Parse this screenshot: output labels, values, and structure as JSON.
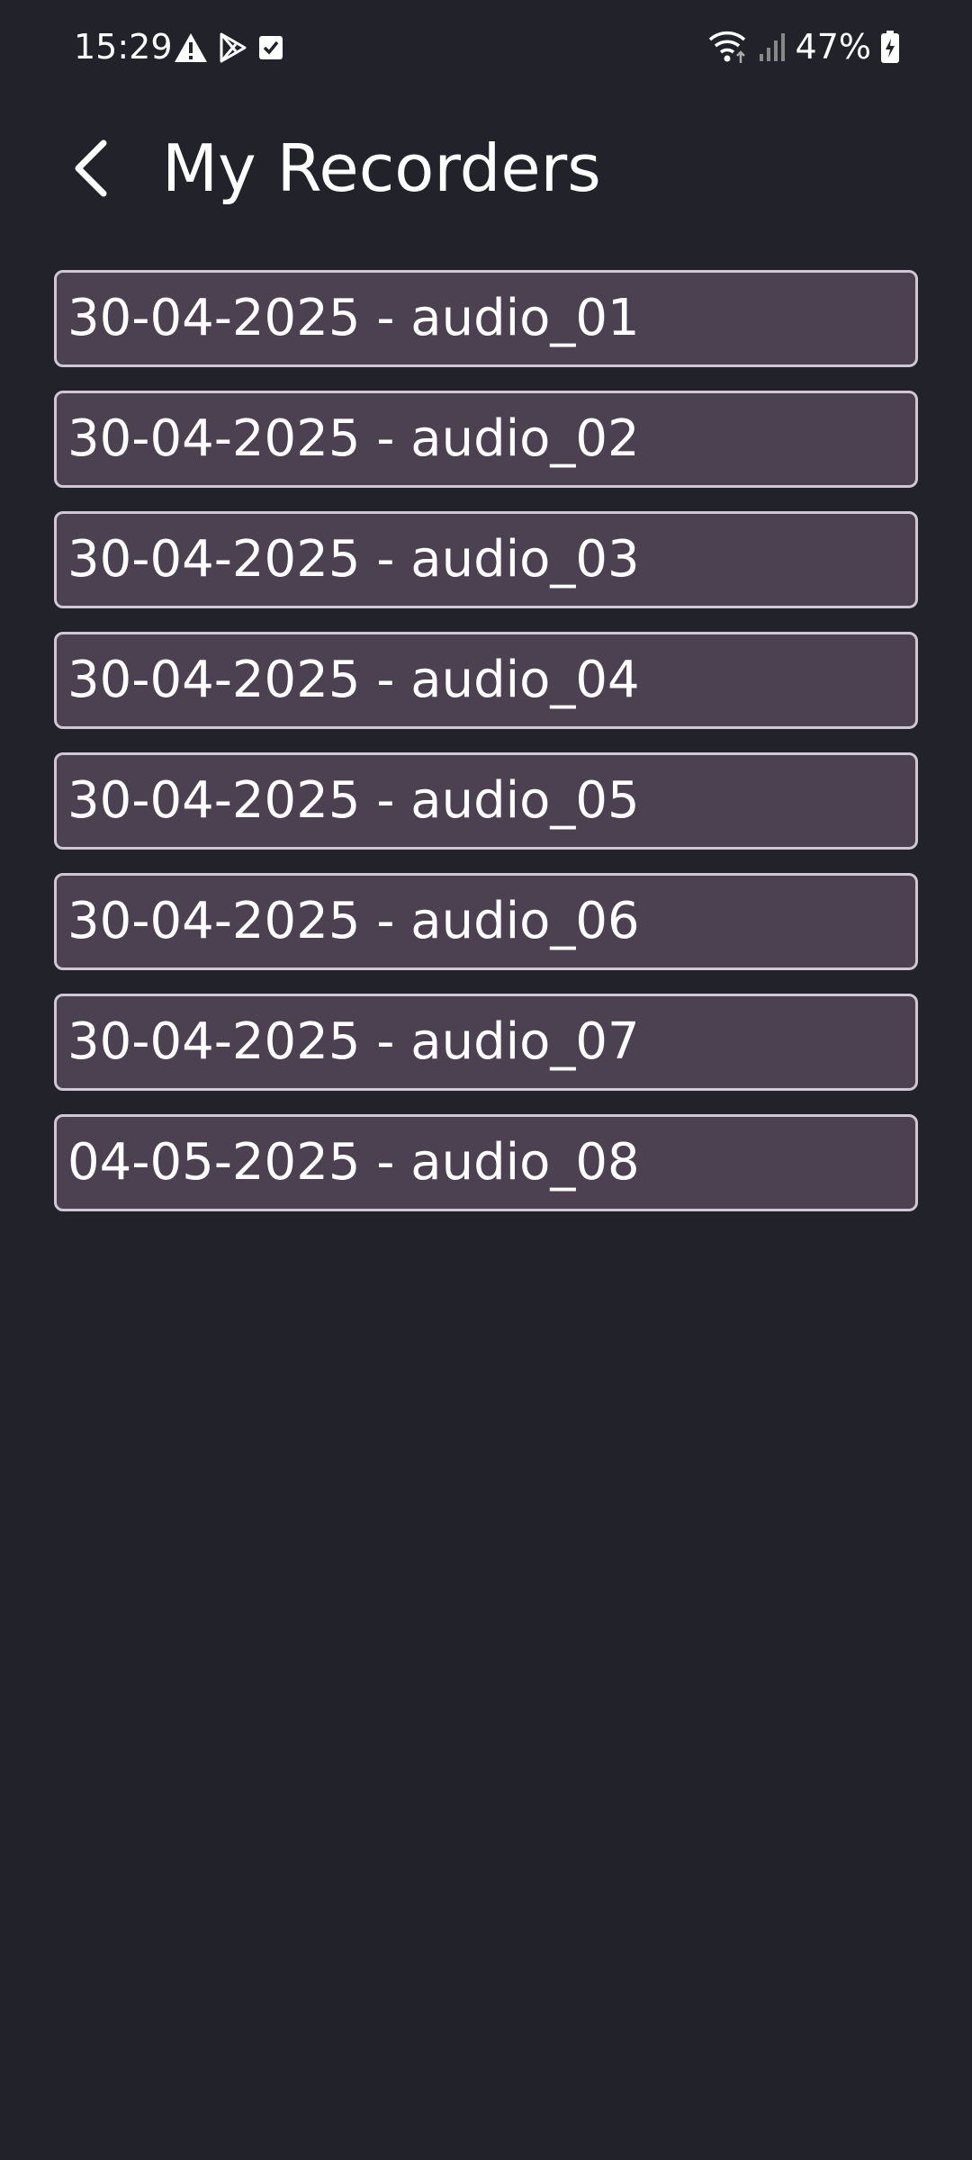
{
  "status_bar": {
    "time": "15:29",
    "left_icons": [
      "warning-icon",
      "play-store-icon",
      "checkbox-icon"
    ],
    "right_icons": [
      "wifi-icon",
      "cellular-signal-icon",
      "battery-charging-icon"
    ],
    "battery": "47%"
  },
  "header": {
    "back_icon": "chevron-left-icon",
    "title": "My Recorders"
  },
  "recordings": [
    {
      "label": "30-04-2025 - audio_01"
    },
    {
      "label": "30-04-2025 - audio_02"
    },
    {
      "label": "30-04-2025 - audio_03"
    },
    {
      "label": "30-04-2025 - audio_04"
    },
    {
      "label": "30-04-2025 - audio_05"
    },
    {
      "label": "30-04-2025 - audio_06"
    },
    {
      "label": "30-04-2025 - audio_07"
    },
    {
      "label": "04-05-2025 - audio_08"
    }
  ],
  "colors": {
    "background": "#22222b",
    "item_fill": "#4b4150",
    "item_border": "#cfc6d6",
    "text": "#ffffff"
  }
}
